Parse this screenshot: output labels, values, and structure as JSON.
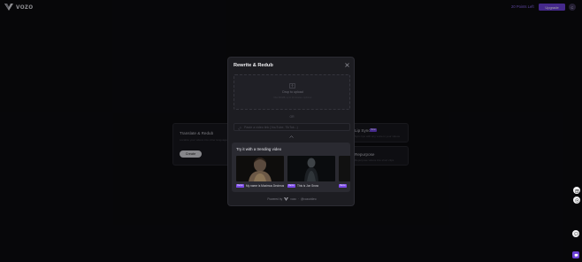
{
  "header": {
    "logo_text": "vozo",
    "credits": "20 Points Left",
    "upgrade_label": "Upgrade",
    "avatar_initial": "C"
  },
  "background": {
    "translate_card": {
      "title": "Translate & Redub",
      "subtitle": "Localize your videos into other languages",
      "button": "Create"
    },
    "lipsync_card": {
      "title": "Lip Sync",
      "badge": "New",
      "subtitle": "Sync lips with any voice in your videos"
    },
    "repurpose_card": {
      "title": "Repurpose",
      "subtitle": "Repurpose videos into short clips"
    }
  },
  "modal": {
    "title": "Rewrite & Redub",
    "dropzone": {
      "text": "Drop to upload",
      "hint": "Max 500MB, up to 10 minutes, mp4/mov"
    },
    "or_text": "OR",
    "url_placeholder": "Paste a video link (YouTube, TikTok...)",
    "trending": {
      "title": "Try it with a trending video",
      "videos": [
        {
          "badge": "Demo",
          "title": "My name is Maximus Decimus Meridius"
        },
        {
          "badge": "Demo",
          "title": "This is Jon Snow"
        },
        {
          "badge": "Demo",
          "title": ""
        }
      ]
    },
    "powered_by": {
      "prefix": "Powered by",
      "brand": "vozo",
      "suffix": "@vozovideo"
    }
  },
  "colors": {
    "accent": "#6a3fd6",
    "background": "#0b0b0f",
    "modal": "#1d1d22"
  },
  "icons": [
    "close-icon",
    "upload-icon",
    "link-icon",
    "chevron-up-icon",
    "gift-icon",
    "chat-icon",
    "help-icon",
    "vozo-logo-icon"
  ]
}
